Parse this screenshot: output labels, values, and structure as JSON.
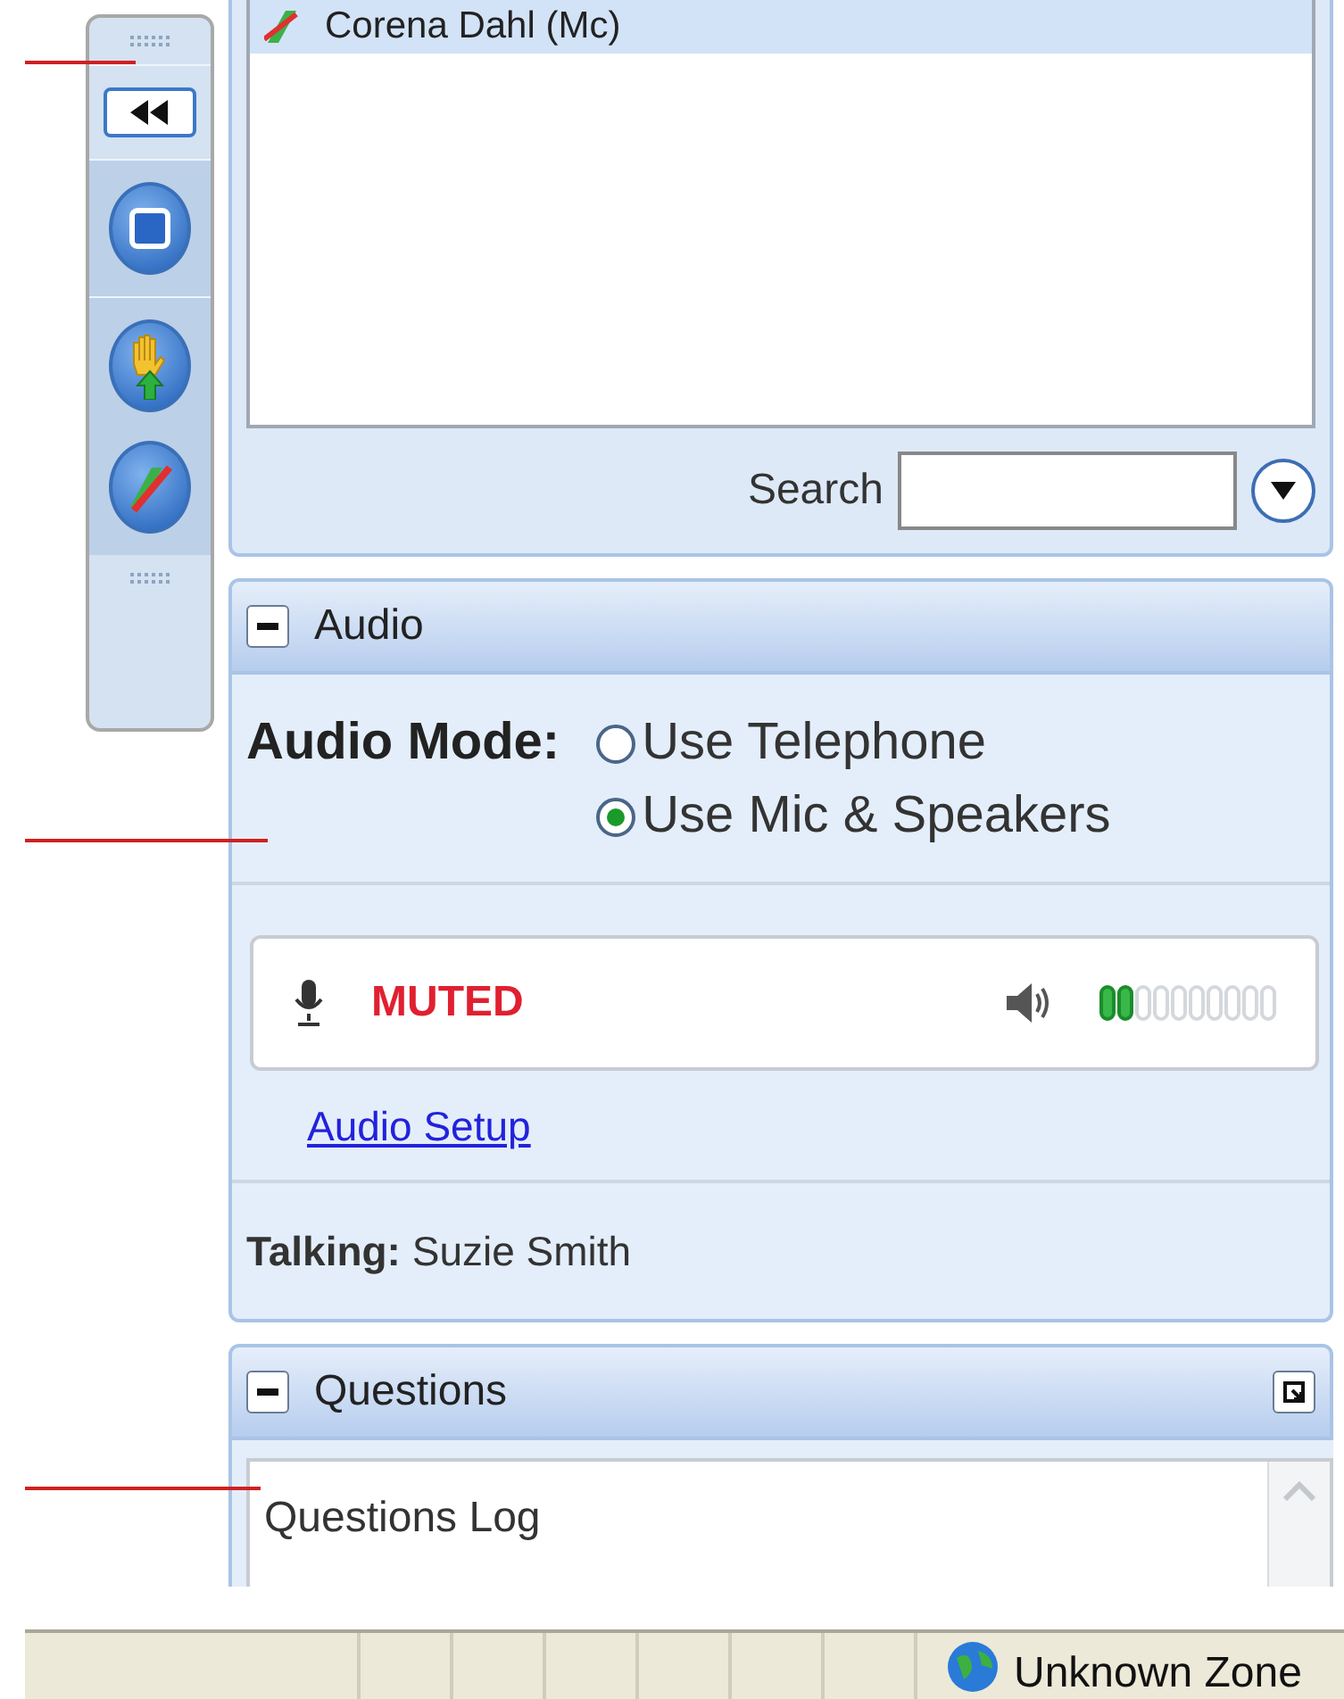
{
  "toolbar": {
    "buttons": [
      {
        "kind": "collapse"
      },
      {
        "kind": "window"
      },
      {
        "kind": "raise-hand"
      },
      {
        "kind": "mic-off"
      }
    ]
  },
  "participants": {
    "items": [
      {
        "name": "Corena Dahl (Mc)",
        "selected": true
      }
    ],
    "search": {
      "label": "Search"
    }
  },
  "audio": {
    "title": "Audio",
    "expanded": true,
    "mode_label": "Audio Mode:",
    "options": [
      {
        "label": "Use Telephone",
        "selected": false
      },
      {
        "label": "Use Mic & Speakers",
        "selected": true
      }
    ],
    "mic": {
      "status": "MUTED",
      "muted": true
    },
    "speaker": {
      "level": 0.2
    },
    "setup_link": "Audio Setup",
    "talking": {
      "label": "Talking:",
      "name": "Suzie Smith"
    }
  },
  "questions": {
    "title": "Questions",
    "expanded": true,
    "log_title": "Questions Log"
  },
  "status_bar": {
    "zone": "Unknown Zone"
  }
}
